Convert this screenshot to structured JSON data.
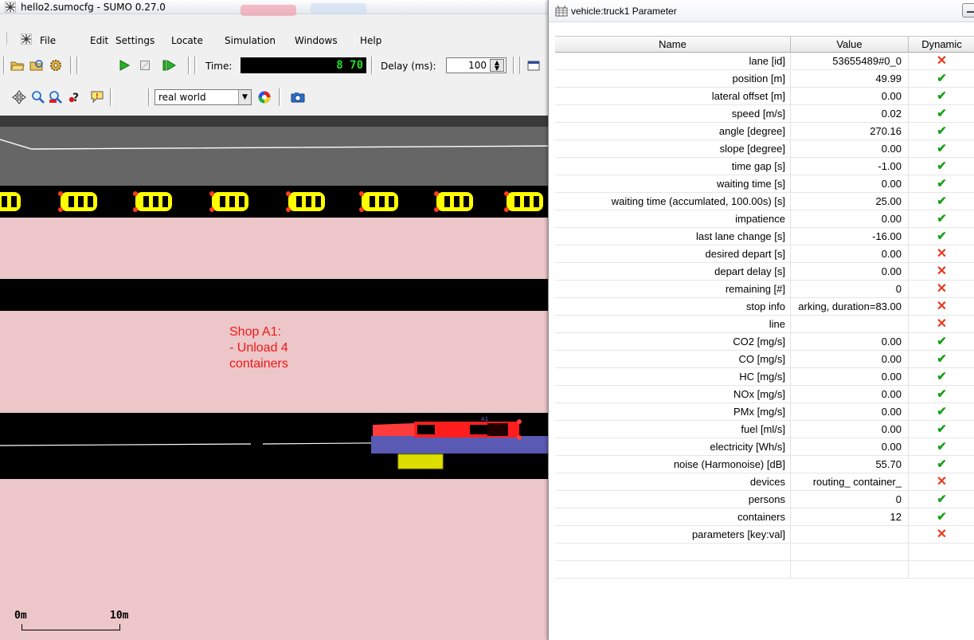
{
  "window": {
    "title": "hello2.sumocfg - SUMO 0.27.0"
  },
  "menu": {
    "file": "File",
    "edit": "Edit",
    "settings": "Settings",
    "locate": "Locate",
    "simulation": "Simulation",
    "windows": "Windows",
    "help": "Help"
  },
  "toolbar": {
    "time_label": "Time:",
    "time_value": "8 70",
    "delay_label": "Delay (ms):",
    "delay_value": "100",
    "scheme_value": "real world"
  },
  "canvas": {
    "annotation": [
      "Shop A1:",
      "- Unload 4",
      "containers"
    ],
    "scale_start": "0m",
    "scale_end": "10m",
    "vehicle_tag": "A1"
  },
  "dialog": {
    "title": "vehicle:truck1 Parameter",
    "columns": {
      "name": "Name",
      "value": "Value",
      "dynamic": "Dynamic"
    },
    "rows": [
      {
        "name": "lane [id]",
        "value": "53655489#0_0",
        "dynamic": false
      },
      {
        "name": "position [m]",
        "value": "49.99",
        "dynamic": true
      },
      {
        "name": "lateral offset [m]",
        "value": "0.00",
        "dynamic": true
      },
      {
        "name": "speed [m/s]",
        "value": "0.02",
        "dynamic": true
      },
      {
        "name": "angle [degree]",
        "value": "270.16",
        "dynamic": true
      },
      {
        "name": "slope [degree]",
        "value": "0.00",
        "dynamic": true
      },
      {
        "name": "time gap [s]",
        "value": "-1.00",
        "dynamic": true
      },
      {
        "name": "waiting time [s]",
        "value": "0.00",
        "dynamic": true
      },
      {
        "name": "waiting time (accumlated, 100.00s) [s]",
        "value": "25.00",
        "dynamic": true
      },
      {
        "name": "impatience",
        "value": "0.00",
        "dynamic": true
      },
      {
        "name": "last lane change [s]",
        "value": "-16.00",
        "dynamic": true
      },
      {
        "name": "desired depart [s]",
        "value": "0.00",
        "dynamic": false
      },
      {
        "name": "depart delay [s]",
        "value": "0.00",
        "dynamic": false
      },
      {
        "name": "remaining [#]",
        "value": "0",
        "dynamic": false
      },
      {
        "name": "stop info",
        "value": "arking, duration=83.00",
        "dynamic": false
      },
      {
        "name": "line",
        "value": "",
        "dynamic": false
      },
      {
        "name": "CO2 [mg/s]",
        "value": "0.00",
        "dynamic": true
      },
      {
        "name": "CO [mg/s]",
        "value": "0.00",
        "dynamic": true
      },
      {
        "name": "HC [mg/s]",
        "value": "0.00",
        "dynamic": true
      },
      {
        "name": "NOx [mg/s]",
        "value": "0.00",
        "dynamic": true
      },
      {
        "name": "PMx [mg/s]",
        "value": "0.00",
        "dynamic": true
      },
      {
        "name": "fuel [ml/s]",
        "value": "0.00",
        "dynamic": true
      },
      {
        "name": "electricity [Wh/s]",
        "value": "0.00",
        "dynamic": true
      },
      {
        "name": "noise (Harmonoise) [dB]",
        "value": "55.70",
        "dynamic": true
      },
      {
        "name": "devices",
        "value": "routing_ container_",
        "dynamic": false
      },
      {
        "name": "persons",
        "value": "0",
        "dynamic": true
      },
      {
        "name": "containers",
        "value": "12",
        "dynamic": true
      },
      {
        "name": "parameters [key:val]",
        "value": "",
        "dynamic": false
      }
    ],
    "marks": {
      "yes": "✔",
      "no": "✕"
    }
  },
  "colors": {
    "canvas_bg": "#ecc6c8",
    "road": "#000000",
    "lane_marking": "#ffffff",
    "sidewalk": "#666666",
    "car_body": "#ffff00",
    "truck_body": "#ff1e1e",
    "container_stop": "#5a5ab4",
    "stop_marker": "#dddd00",
    "annotation": "#f01818",
    "dyn_yes": "#1ca01c",
    "dyn_no": "#e63a1e"
  },
  "icons": [
    "sumo-app-icon",
    "open-file-icon",
    "reload-icon",
    "gear-icon",
    "play-icon",
    "stop-icon",
    "step-icon",
    "recenter-icon",
    "zoom-icon",
    "locate-vehicle-icon",
    "edit-icon",
    "speech-icon",
    "color-wheel-icon",
    "camera-icon",
    "minimize-icon"
  ]
}
